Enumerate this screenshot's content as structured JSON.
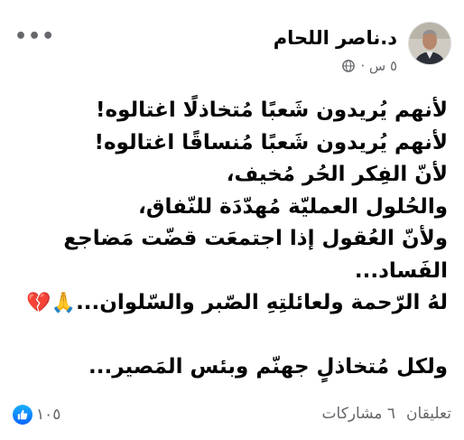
{
  "post": {
    "author": "د.ناصر اللحام",
    "time": "٥ س ·",
    "privacy_icon": "globe-icon",
    "more_icon": "more-icon",
    "lines": [
      "لأنهم يُريدون شَعبًا مُتخاذلًا اغتالوه!",
      "لأنهم يُريدون شَعبًا مُنساقًا اغتالوه!",
      "لأنّ الفِكر الحُر مُخيف،",
      "والحُلول العمليّة مُهدّدَة للنّفاق،",
      "ولأنّ العُقول إذا اجتمعَت قضّت مَضاجع",
      "الفَساد...",
      "لهُ الرّحمة ولعائلتِهِ الصّبر والسّلوان...",
      "",
      "ولكل مُتخاذلٍ جهنّم وبئس المَصير..."
    ],
    "emoji_line_index": 6,
    "emoji_text": "🙏💔",
    "reaction_icon": "like-icon",
    "reaction_count": "١٠٥",
    "shares": "٦ مشاركات",
    "comments": "تعليقان"
  }
}
